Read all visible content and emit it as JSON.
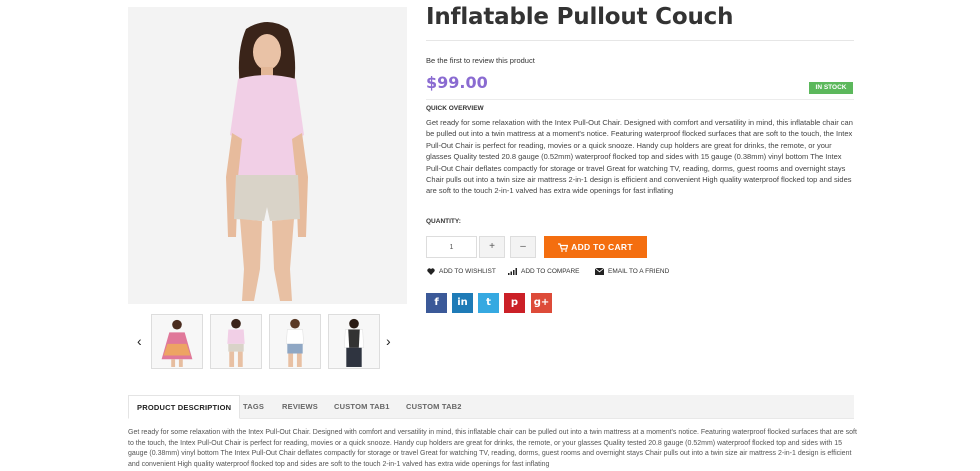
{
  "product": {
    "title": "Inflatable Pullout Couch",
    "review_link": "Be the first to review this product",
    "price": "$99.00",
    "stock_status": "IN STOCK",
    "overview_heading": "QUICK OVERVIEW",
    "overview_text": "Get ready for some relaxation with the Intex Pull-Out Chair. Designed with comfort and versatility in mind, this inflatable chair can be pulled out into a twin mattress at a moment's notice. Featuring waterproof flocked surfaces that are soft to the touch, the Intex Pull-Out Chair is perfect for reading, movies or a quick snooze. Handy cup holders are great for drinks, the remote, or your glasses Quality tested 20.8 gauge (0.52mm) waterproof flocked top and sides with 15 gauge (0.38mm) vinyl bottom The Intex Pull-Out Chair deflates compactly for storage or travel Great for watching TV, reading, dorms, guest rooms and overnight stays Chair pulls out into a twin size air mattress 2-in-1 design is efficient and convenient High quality waterproof flocked top and sides are soft to the touch 2-in-1 valved has extra wide openings for fast inflating"
  },
  "purchase": {
    "quantity_label": "QUANTITY:",
    "quantity_value": "1",
    "plus_label": "+",
    "minus_label": "–",
    "add_to_cart_label": "ADD TO CART"
  },
  "actions": {
    "wishlist_label": "ADD TO WISHLIST",
    "compare_label": "ADD TO COMPARE",
    "email_label": "EMAIL TO A FRIEND"
  },
  "social": {
    "facebook": "f",
    "linkedin": "in",
    "twitter": "t",
    "pinterest": "p",
    "googleplus": "g+"
  },
  "gallery": {
    "prev_arrow": "‹",
    "next_arrow": "›",
    "thumbnails": [
      "floral-dress",
      "pink-top-shorts",
      "white-top-jeans",
      "man-vest"
    ]
  },
  "tabs": {
    "items": [
      "PRODUCT DESCRIPTION",
      "TAGS",
      "REVIEWS",
      "CUSTOM TAB1",
      "CUSTOM TAB2"
    ],
    "description_text": "Get ready for some relaxation with the Intex Pull-Out Chair. Designed with comfort and versatility in mind, this inflatable chair can be pulled out into a twin mattress at a moment's notice. Featuring waterproof flocked surfaces that are soft to the touch, the Intex Pull-Out Chair is perfect for reading, movies or a quick snooze. Handy cup holders are great for drinks, the remote, or your glasses Quality tested 20.8 gauge (0.52mm) waterproof flocked top and sides with 15 gauge (0.38mm) vinyl bottom The Intex Pull-Out Chair deflates compactly for storage or travel Great for watching TV, reading, dorms, guest rooms and overnight stays Chair pulls out into a twin size air mattress 2-in-1 design is efficient and convenient High quality waterproof flocked top and sides are soft to the touch 2-in-1 valved has extra wide openings for fast inflating"
  },
  "colors": {
    "price": "#8a6bd1",
    "in_stock": "#5cb85c",
    "add_to_cart": "#f46e0f",
    "facebook": "#3b5998",
    "linkedin": "#1e7bb7",
    "twitter": "#36a9e1",
    "pinterest": "#cb2027",
    "googleplus": "#dd4b39"
  }
}
